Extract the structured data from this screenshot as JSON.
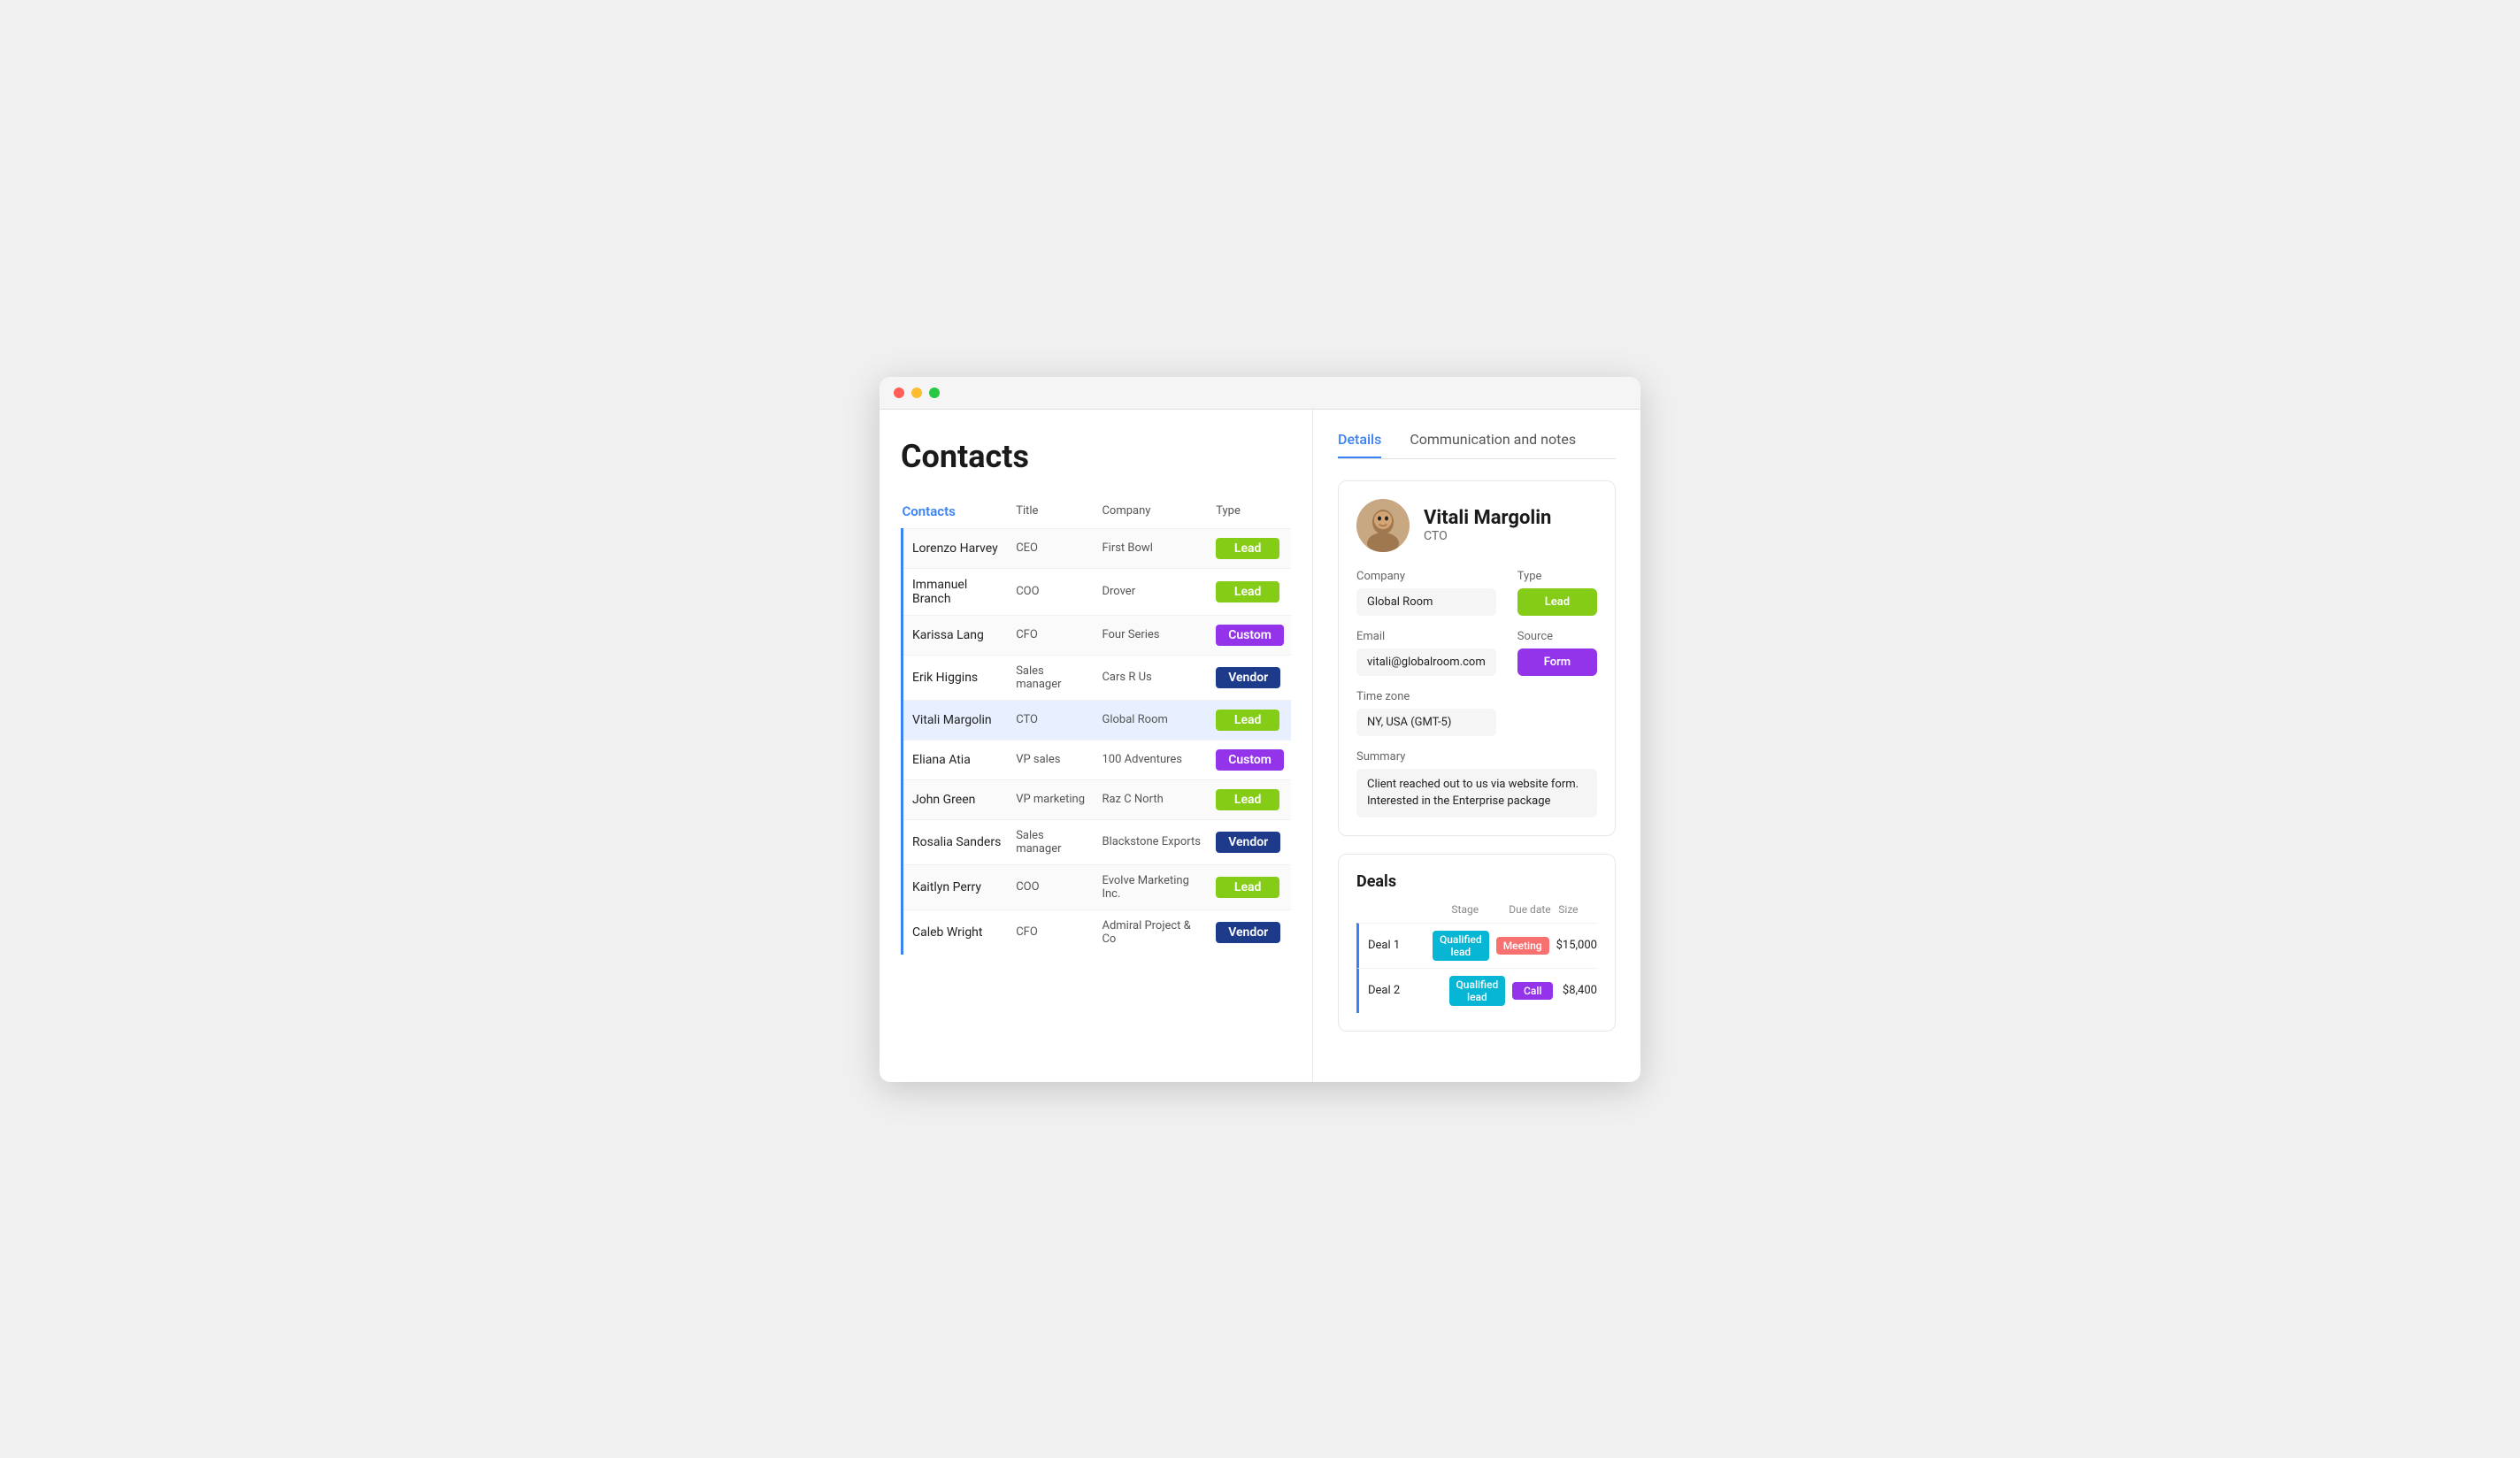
{
  "window": {
    "title": "Contacts"
  },
  "page": {
    "title": "Contacts"
  },
  "left": {
    "columns": {
      "contacts": "Contacts",
      "title": "Title",
      "company": "Company",
      "type": "Type"
    },
    "rows": [
      {
        "name": "Lorenzo Harvey",
        "title": "CEO",
        "company": "First Bowl",
        "type": "Lead",
        "typeClass": "type-lead",
        "active": false
      },
      {
        "name": "Immanuel Branch",
        "title": "COO",
        "company": "Drover",
        "type": "Lead",
        "typeClass": "type-lead",
        "active": false
      },
      {
        "name": "Karissa Lang",
        "title": "CFO",
        "company": "Four Series",
        "type": "Custom",
        "typeClass": "type-custom",
        "active": false
      },
      {
        "name": "Erik Higgins",
        "title": "Sales manager",
        "company": "Cars R Us",
        "type": "Vendor",
        "typeClass": "type-vendor",
        "active": false
      },
      {
        "name": "Vitali Margolin",
        "title": "CTO",
        "company": "Global Room",
        "type": "Lead",
        "typeClass": "type-lead",
        "active": true
      },
      {
        "name": "Eliana Atia",
        "title": "VP sales",
        "company": "100 Adventures",
        "type": "Custom",
        "typeClass": "type-custom",
        "active": false
      },
      {
        "name": "John Green",
        "title": "VP marketing",
        "company": "Raz C North",
        "type": "Lead",
        "typeClass": "type-lead",
        "active": false
      },
      {
        "name": "Rosalia Sanders",
        "title": "Sales manager",
        "company": "Blackstone Exports",
        "type": "Vendor",
        "typeClass": "type-vendor",
        "active": false
      },
      {
        "name": "Kaitlyn Perry",
        "title": "COO",
        "company": "Evolve Marketing Inc.",
        "type": "Lead",
        "typeClass": "type-lead",
        "active": false
      },
      {
        "name": "Caleb Wright",
        "title": "CFO",
        "company": "Admiral Project & Co",
        "type": "Vendor",
        "typeClass": "type-vendor",
        "active": false
      }
    ]
  },
  "right": {
    "tabs": [
      {
        "label": "Details",
        "active": true
      },
      {
        "label": "Communication and notes",
        "active": false
      }
    ],
    "contact": {
      "name": "Vitali Margolin",
      "role": "CTO",
      "company": "Global Room",
      "email": "vitali@globalroom.com",
      "timezone": "NY, USA (GMT-5)",
      "type": "Lead",
      "typeClass": "type-lead",
      "source": "Form",
      "sourceColor": "#9333ea",
      "summary": "Client reached out to us via website form. Interested in the Enterprise package"
    },
    "deals": {
      "title": "Deals",
      "columns": {
        "stage": "Stage",
        "dueDate": "Due date",
        "size": "Size"
      },
      "rows": [
        {
          "name": "Deal 1",
          "stage": "Qualified lead",
          "dueDate": "Meeting",
          "dueDateClass": "due-meeting",
          "size": "$15,000"
        },
        {
          "name": "Deal 2",
          "stage": "Qualified lead",
          "dueDate": "Call",
          "dueDateClass": "due-call",
          "size": "$8,400"
        }
      ]
    }
  }
}
